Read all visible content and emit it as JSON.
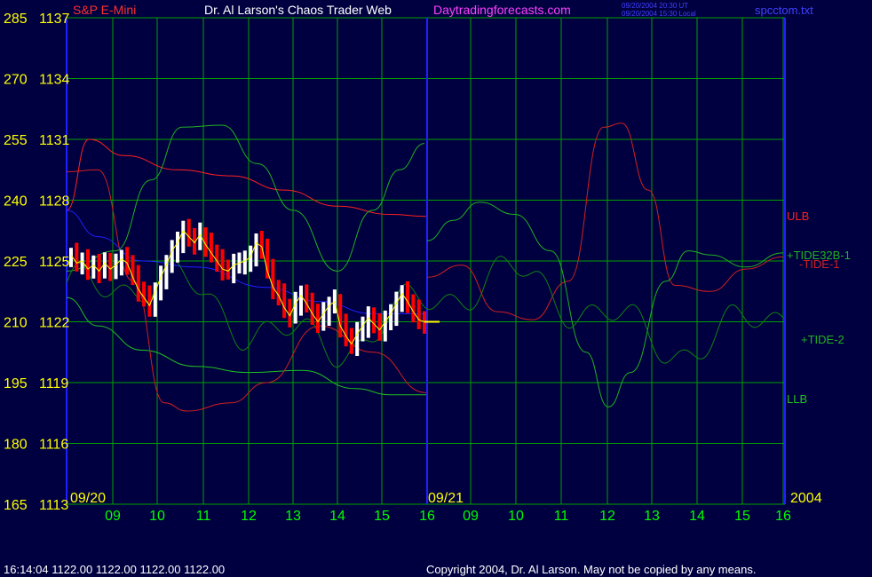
{
  "header": {
    "instrument": "S&P E-Mini",
    "site_title": "Dr. Al Larson's Chaos Trader Web",
    "site_url": "Daytradingforecasts.com",
    "timestamp_ut": "09/20/2004 20:30 UT",
    "timestamp_local": "09/20/2004 15:30 Local",
    "filename": "spcctom.txt"
  },
  "footer": {
    "quote": "16:14:04   1122.00 1122.00 1122.00 1122.00",
    "copyright": "Copyright 2004, Dr. Al Larson. May not be copied by any means."
  },
  "colors": {
    "background": "#000040",
    "grid": "#00a000",
    "axis_text": "#ffff00",
    "hour_text": "#00ff00",
    "day_divider": "#2020ff",
    "price_up": "#ffffff",
    "price_down": "#ff0000",
    "ulb": "#ff2020",
    "llb": "#20c020",
    "tide32b": "#20b020",
    "tide1": "#d02020",
    "tide2": "#108010",
    "avg_line": "#2020ff",
    "close_line": "#ffff00"
  },
  "chart_data": {
    "type": "line",
    "title": "S&P E-Mini",
    "y_left_labels": [
      "285",
      "270",
      "255",
      "240",
      "225",
      "210",
      "195",
      "180",
      "165"
    ],
    "y_right_labels": [
      "1137",
      "1134",
      "1131",
      "1128",
      "1125",
      "1122",
      "1119",
      "1116",
      "1113"
    ],
    "y_price_range": [
      1113,
      1137
    ],
    "x_hour_labels": [
      "09",
      "10",
      "11",
      "12",
      "13",
      "14",
      "15",
      "16",
      "09",
      "10",
      "11",
      "12",
      "13",
      "14",
      "15",
      "16"
    ],
    "date_labels": [
      "09/20",
      "09/21",
      "2004"
    ],
    "series_labels": {
      "ulb": "ULB",
      "llb": "LLB",
      "tide32b": "+TIDE32B-1",
      "tide1": "-TIDE-1",
      "tide2": "+TIDE-2"
    },
    "last_price": 1122.0,
    "ohlc_day1_close": [
      1125.3,
      1124.9,
      1125.0,
      1124.6,
      1124.8,
      1124.5,
      1124.9,
      1124.6,
      1124.8,
      1125.1,
      1124.9,
      1124.2,
      1123.6,
      1123.2,
      1122.8,
      1123.5,
      1124.2,
      1124.8,
      1125.5,
      1125.9,
      1126.5,
      1126.2,
      1125.9,
      1126.3,
      1125.8,
      1125.4,
      1125.0,
      1124.6,
      1124.5,
      1124.8,
      1124.9,
      1125.0,
      1125.2,
      1125.9,
      1125.7,
      1124.5,
      1123.7,
      1123.3,
      1122.7,
      1122.3,
      1122.9,
      1123.3,
      1122.9,
      1122.4,
      1122.0,
      1122.4,
      1122.8,
      1123.0,
      1121.8,
      1121.3,
      1120.9,
      1121.4,
      1121.8,
      1122.2,
      1121.9,
      1121.6,
      1122.0,
      1122.4,
      1122.9,
      1123.4,
      1123.0,
      1122.5,
      1122.1,
      1122.0
    ]
  }
}
